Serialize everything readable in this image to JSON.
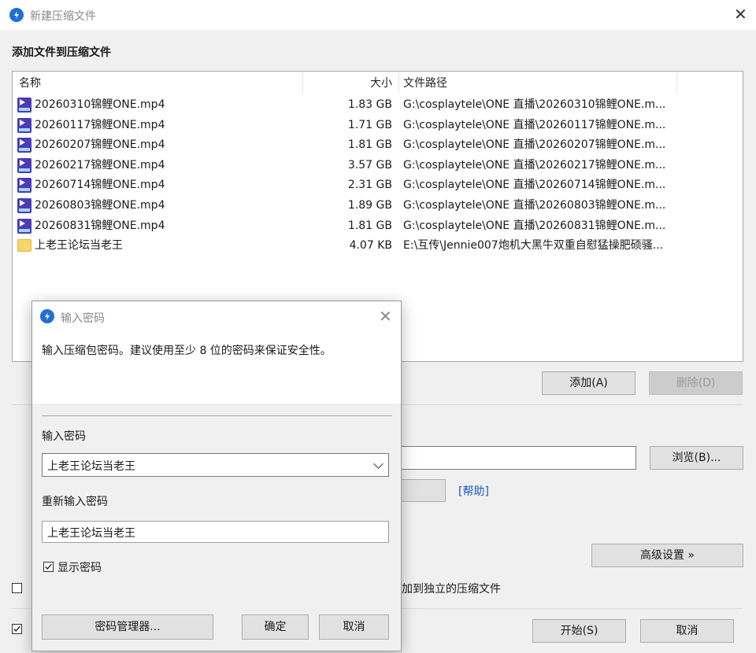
{
  "window": {
    "title": "新建压缩文件",
    "heading": "添加文件到压缩文件"
  },
  "file_list": {
    "columns": {
      "name": "名称",
      "size": "大小",
      "path": "文件路径"
    },
    "rows": [
      {
        "icon": "mp4-file-icon",
        "name": "20260310锦鲤ONE.mp4",
        "size": "1.83 GB",
        "path": "G:\\cosplaytele\\ONE 直播\\20260310锦鲤ONE.m..."
      },
      {
        "icon": "mp4-file-icon",
        "name": "20260117锦鲤ONE.mp4",
        "size": "1.71 GB",
        "path": "G:\\cosplaytele\\ONE 直播\\20260117锦鲤ONE.m..."
      },
      {
        "icon": "mp4-file-icon",
        "name": "20260207锦鲤ONE.mp4",
        "size": "1.81 GB",
        "path": "G:\\cosplaytele\\ONE 直播\\20260207锦鲤ONE.m..."
      },
      {
        "icon": "mp4-file-icon",
        "name": "20260217锦鲤ONE.mp4",
        "size": "3.57 GB",
        "path": "G:\\cosplaytele\\ONE 直播\\20260217锦鲤ONE.m..."
      },
      {
        "icon": "mp4-file-icon",
        "name": "20260714锦鲤ONE.mp4",
        "size": "2.31 GB",
        "path": "G:\\cosplaytele\\ONE 直播\\20260714锦鲤ONE.m..."
      },
      {
        "icon": "mp4-file-icon",
        "name": "20260803锦鲤ONE.mp4",
        "size": "1.89 GB",
        "path": "G:\\cosplaytele\\ONE 直播\\20260803锦鲤ONE.m..."
      },
      {
        "icon": "mp4-file-icon",
        "name": "20260831锦鲤ONE.mp4",
        "size": "1.81 GB",
        "path": "G:\\cosplaytele\\ONE 直播\\20260831锦鲤ONE.m..."
      },
      {
        "icon": "folder-icon",
        "name": "上老王论坛当老王",
        "size": "4.07 KB",
        "path": "E:\\互传\\Jennie007炮机大黑牛双重自慰猛操肥硕骚..."
      }
    ]
  },
  "main_buttons": {
    "add": "添加(A)",
    "remove": "删除(D)",
    "browse": "浏览(B)...",
    "help": "[帮助]",
    "advanced": "高级设置 »",
    "start": "开始(S)",
    "cancel": "取消",
    "separate_archive_label": "加到独立的压缩文件"
  },
  "password_dialog": {
    "title": "输入密码",
    "info": "输入压缩包密码。建议使用至少 8 位的密码来保证安全性。",
    "password_label": "输入密码",
    "password_value": "上老王论坛当老王",
    "confirm_label": "重新输入密码",
    "confirm_value": "上老王论坛当老王",
    "show_password_label": "显示密码",
    "show_password_checked": true,
    "manager_button": "密码管理器...",
    "ok_button": "确定",
    "cancel_button": "取消"
  },
  "colors": {
    "accent": "#1f6fd6",
    "link": "#1a56c8",
    "mp4_icon": "#4b3bb8",
    "folder_icon": "#f7d56b"
  }
}
